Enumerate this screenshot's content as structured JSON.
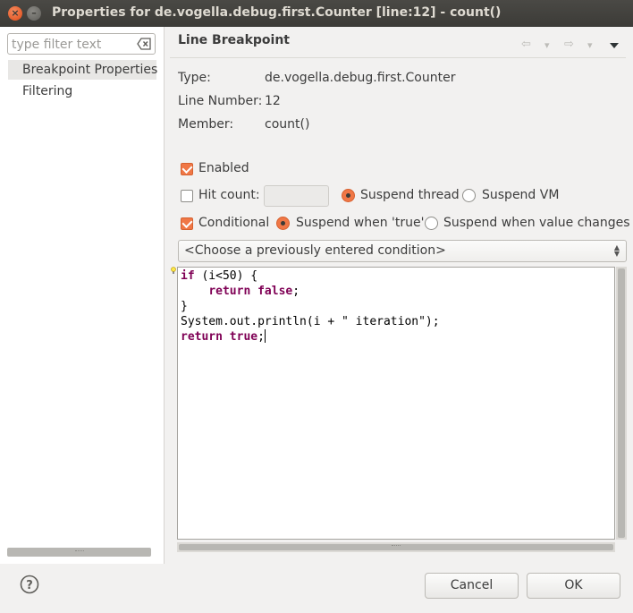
{
  "window": {
    "title": "Properties for de.vogella.debug.first.Counter [line:12] - count()",
    "close_glyph": "×",
    "minimize_glyph": "–"
  },
  "sidebar": {
    "filter_placeholder": "type filter text",
    "filter_value": "",
    "items": [
      {
        "label": "Breakpoint Properties",
        "selected": true
      },
      {
        "label": "Filtering",
        "selected": false
      }
    ]
  },
  "panel": {
    "title": "Line Breakpoint",
    "nav": {
      "back_glyph": "⇦",
      "forward_glyph": "⇨",
      "dropdown_glyph": "▾"
    }
  },
  "info": {
    "type_label": "Type:",
    "type_value": "de.vogella.debug.first.Counter",
    "line_label": "Line Number:",
    "line_value": "12",
    "member_label": "Member:",
    "member_value": "count()"
  },
  "options": {
    "enabled": {
      "label": "Enabled",
      "checked": true
    },
    "hit_count": {
      "label": "Hit count:",
      "checked": false,
      "value": ""
    },
    "suspend_thread": {
      "label": "Suspend thread",
      "selected": true
    },
    "suspend_vm": {
      "label": "Suspend VM",
      "selected": false
    },
    "conditional": {
      "label": "Conditional",
      "checked": true
    },
    "suspend_true": {
      "label": "Suspend when 'true'",
      "selected": true
    },
    "suspend_changes": {
      "label": "Suspend when value changes",
      "selected": false
    }
  },
  "condition_history": {
    "selected": "<Choose a previously entered condition>"
  },
  "editor": {
    "code_lines": [
      "if (i<50) {",
      "    return false;",
      "}",
      "System.out.println(i + \" iteration\");",
      "return true;"
    ],
    "keyword_color": "#7f0055"
  },
  "buttons": {
    "cancel": "Cancel",
    "ok": "OK"
  },
  "colors": {
    "accent": "#f07746",
    "titlebar": "#3c3b37"
  }
}
